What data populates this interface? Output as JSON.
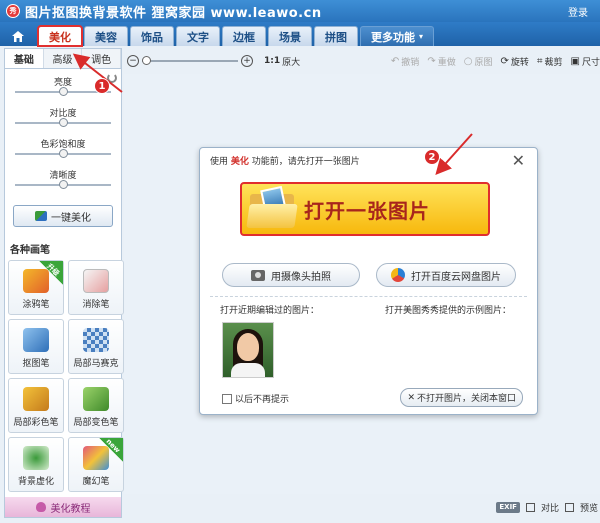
{
  "window": {
    "logo_text": "秀",
    "title": "图片抠图换背景软件 狸窝家园 www.leawo.cn",
    "login": "登录"
  },
  "nav": {
    "tabs": [
      "美化",
      "美容",
      "饰品",
      "文字",
      "边框",
      "场景",
      "拼图"
    ],
    "more": "更多功能",
    "active_index": 0
  },
  "left_panel": {
    "sub_tabs": [
      "基础",
      "高级",
      "调色"
    ],
    "sliders": [
      {
        "label": "亮度",
        "value": 0.5
      },
      {
        "label": "对比度",
        "value": 0.5
      },
      {
        "label": "色彩饱和度",
        "value": 0.5
      },
      {
        "label": "清晰度",
        "value": 0.5
      }
    ],
    "one_key_label": "一键美化",
    "brush_heading": "各种画笔",
    "brushes": [
      {
        "label": "涂鸦笔",
        "badge": "升级"
      },
      {
        "label": "消除笔",
        "badge": ""
      },
      {
        "label": "抠图笔",
        "badge": ""
      },
      {
        "label": "局部马赛克",
        "badge": ""
      },
      {
        "label": "局部彩色笔",
        "badge": ""
      },
      {
        "label": "局部变色笔",
        "badge": ""
      },
      {
        "label": "背景虚化",
        "badge": ""
      },
      {
        "label": "魔幻笔",
        "badge": "new"
      }
    ],
    "tutorial_label": "美化教程"
  },
  "toolbar": {
    "zoom_ratio": "1:1",
    "original_size": "原大",
    "undo": "撤销",
    "redo": "重做",
    "original_image": "原图",
    "rotate": "旋转",
    "crop": "裁剪",
    "resize": "尺寸"
  },
  "dialog": {
    "intro_prefix": "使用",
    "intro_highlight": "美化",
    "intro_suffix": "功能前，请先打开一张图片",
    "open_label": "打开一张图片",
    "camera_label": "用摄像头拍照",
    "cloud_label": "打开百度云网盘图片",
    "recent_label": "打开近期编辑过的图片：",
    "sample_label": "打开美图秀秀提供的示例图片：",
    "no_remind_label": "以后不再提示",
    "close_label": "不打开图片，关闭本窗口"
  },
  "annotations": {
    "step1": "1",
    "step2": "2"
  },
  "statusbar": {
    "exif": "EXIF",
    "compare": "对比",
    "preview": "预览"
  },
  "colors": {
    "title_bar": "#2a74bd",
    "accent_red": "#d92b2b",
    "open_button": "#f7b80d"
  }
}
